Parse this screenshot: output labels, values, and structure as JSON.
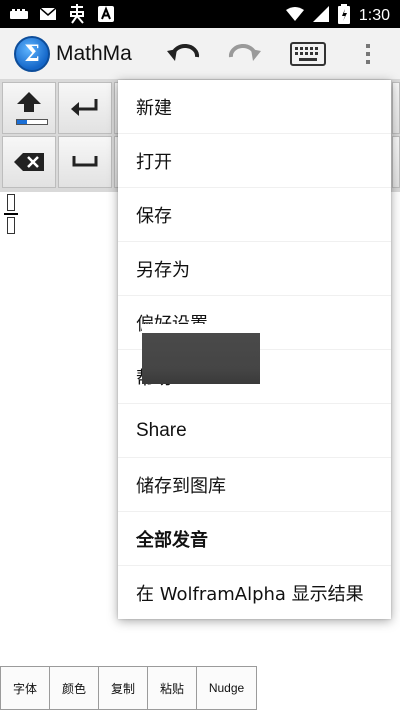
{
  "status_bar": {
    "time": "1:30",
    "left_icons": [
      "sd-card-icon",
      "mail-icon",
      "app-notification-icon",
      "a-icon"
    ],
    "right_icons": [
      "wifi-icon",
      "signal-icon",
      "battery-icon"
    ]
  },
  "toolbar": {
    "app_title": "MathMa",
    "logo_glyph": "Σ",
    "buttons": [
      "undo-icon",
      "redo-icon",
      "keyboard-icon",
      "overflow-menu-icon"
    ]
  },
  "keypad": {
    "keys": [
      "shift-key",
      "enter-key",
      "backspace-key",
      "space-key"
    ]
  },
  "menu": {
    "items": [
      {
        "label": "新建"
      },
      {
        "label": "打开"
      },
      {
        "label": "保存"
      },
      {
        "label": "另存为"
      },
      {
        "label": "偏好设置"
      },
      {
        "label": "帮助"
      },
      {
        "label": "Share"
      },
      {
        "label": "储存到图库"
      },
      {
        "label": "全部发音"
      },
      {
        "label": "在 WolframAlpha 显示结果"
      }
    ]
  },
  "bottom_buttons": [
    {
      "label": "字体"
    },
    {
      "label": "颜色"
    },
    {
      "label": "复制"
    },
    {
      "label": "粘贴"
    },
    {
      "label": "Nudge"
    }
  ],
  "colors": {
    "status_bar": "#000000",
    "toolbar": "#f2f2f2",
    "accent": "#1b6fd6",
    "menu_bg": "#ffffff"
  }
}
